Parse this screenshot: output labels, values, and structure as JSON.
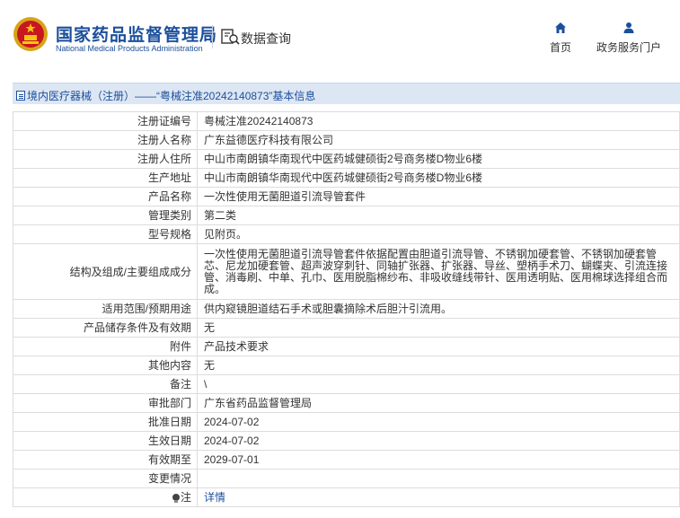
{
  "header": {
    "logo_cn": "国家药品监督管理局",
    "logo_en": "National Medical Products Administration",
    "data_query": "数据查询",
    "nav": [
      {
        "label": "首页",
        "icon": "home-icon"
      },
      {
        "label": "政务服务门户",
        "icon": "user-icon"
      }
    ]
  },
  "title": "境内医疗器械（注册）——“粤械注准20242140873”基本信息",
  "rows": [
    {
      "key": "注册证编号",
      "value": "粤械注准20242140873"
    },
    {
      "key": "注册人名称",
      "value": "广东益德医疗科技有限公司"
    },
    {
      "key": "注册人住所",
      "value": "中山市南朗镇华南现代中医药城健硕街2号商务楼D物业6楼"
    },
    {
      "key": "生产地址",
      "value": "中山市南朗镇华南现代中医药城健硕街2号商务楼D物业6楼"
    },
    {
      "key": "产品名称",
      "value": "一次性使用无菌胆道引流导管套件"
    },
    {
      "key": "管理类别",
      "value": "第二类"
    },
    {
      "key": "型号规格",
      "value": "见附页。"
    },
    {
      "key": "结构及组成/主要组成成分",
      "value": "一次性使用无菌胆道引流导管套件依据配置由胆道引流导管、不锈钢加硬套管、不锈钢加硬套管芯、尼龙加硬套管、超声波穿刺针、同轴扩张器、扩张器、导丝、塑柄手术刀、蝴蝶夹、引流连接管、消毒刷、中单、孔巾、医用脱脂棉纱布、非吸收缝线带针、医用透明贴、医用棉球选择组合而成。"
    },
    {
      "key": "适用范围/预期用途",
      "value": "供内窥镜胆道结石手术或胆囊摘除术后胆汁引流用。"
    },
    {
      "key": "产品储存条件及有效期",
      "value": "无"
    },
    {
      "key": "附件",
      "value": "产品技术要求"
    },
    {
      "key": "其他内容",
      "value": "无"
    },
    {
      "key": "备注",
      "value": "\\"
    },
    {
      "key": "审批部门",
      "value": "广东省药品监督管理局"
    },
    {
      "key": "批准日期",
      "value": "2024-07-02"
    },
    {
      "key": "生效日期",
      "value": "2024-07-02"
    },
    {
      "key": "有效期至",
      "value": "2029-07-01"
    },
    {
      "key": "变更情况",
      "value": ""
    },
    {
      "key": "注",
      "value": "详情"
    }
  ]
}
